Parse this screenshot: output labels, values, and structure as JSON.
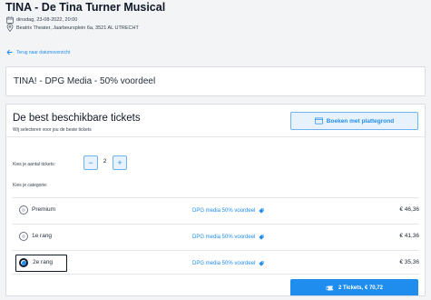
{
  "event": {
    "title": "TINA - De Tina Turner Musical",
    "date": "dinsdag, 23-08-2022, 20:00",
    "venue": "Beatrix Theater, Jaarbeursplein 6a, 3521 AL UTRECHT",
    "calendar_icon": "calendar-icon",
    "location_icon": "location-pin-icon"
  },
  "back_link": {
    "label": "Terug naar datumoverzicht",
    "icon": "arrow-left-icon"
  },
  "offer": {
    "title": "TINA! - DPG Media - 50% voordeel"
  },
  "tickets": {
    "title": "De best beschikbare tickets",
    "subtitle": "Wij selecteren voor jou de beste tickets",
    "plan_button": "Boeken met plattegrond",
    "plan_icon": "seat-map-icon",
    "quantity_label": "Kies je aantal tickets:",
    "quantity": "2",
    "minus_symbol": "−",
    "plus_symbol": "+",
    "category_label": "Kies je categorie:",
    "categories": [
      {
        "name": "Premium",
        "deal": "DPG media 50% voordeel",
        "price": "€ 46,36",
        "selected": false
      },
      {
        "name": "1e rang",
        "deal": "DPG media 50% voordeel",
        "price": "€ 41,36",
        "selected": false
      },
      {
        "name": "2e rang",
        "deal": "DPG media 50% voordeel",
        "price": "€ 35,36",
        "selected": true
      }
    ],
    "buy_button": "2 Tickets, € 70,72",
    "buy_icon": "ticket-icon"
  },
  "colors": {
    "accent": "#1f8ded",
    "accent_light": "#e8f2fc",
    "text": "#1f2937",
    "background": "#f3f4f6"
  }
}
